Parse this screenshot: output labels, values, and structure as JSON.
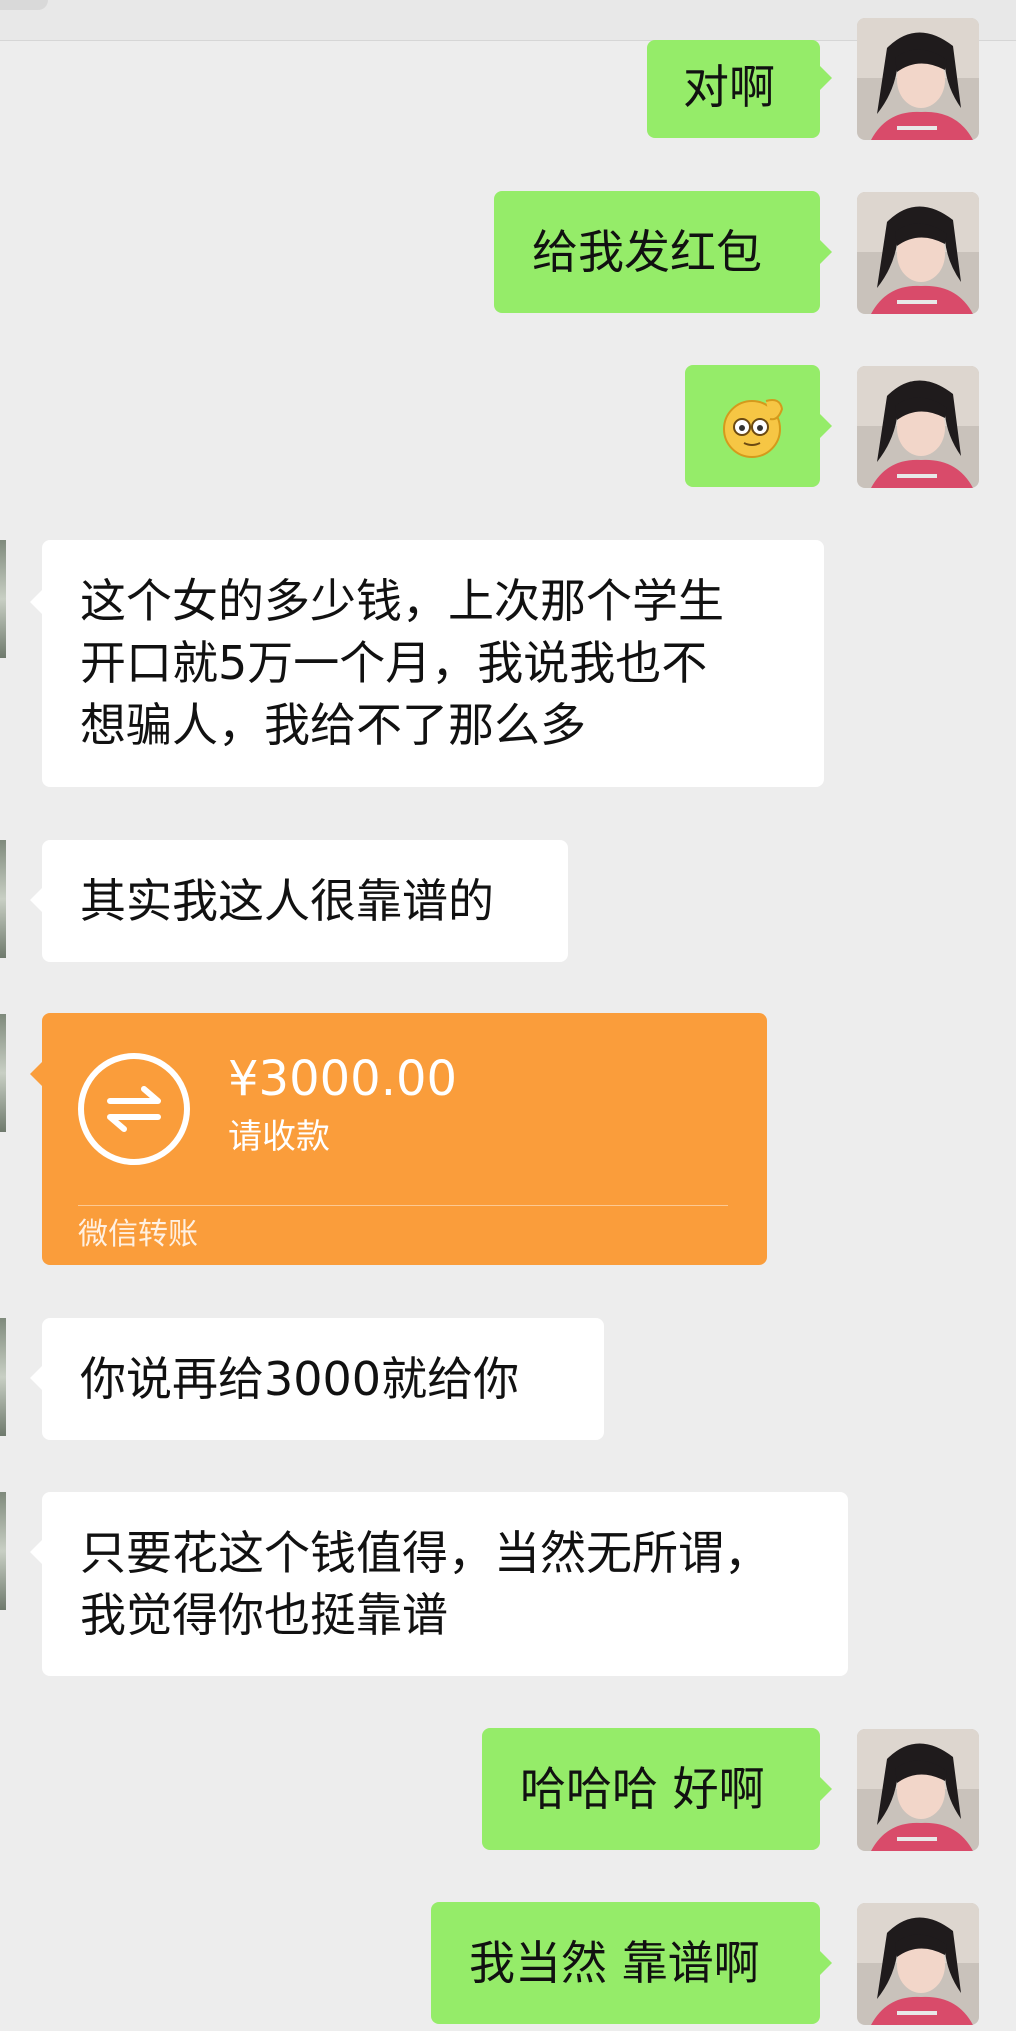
{
  "messages": {
    "m1": {
      "text": "对啊"
    },
    "m2": {
      "text": "给我发红包"
    },
    "m3": {
      "emoji": "salute-face-emoji"
    },
    "m4": {
      "line1": "这个女的多少钱，上次那个学生",
      "line2": "开口就5万一个月，我说我也不",
      "line3": "想骗人，我给不了那么多"
    },
    "m5": {
      "text": "其实我这人很靠谱的"
    },
    "m6": {
      "amount": "¥3000.00",
      "status": "请收款",
      "label": "微信转账"
    },
    "m7": {
      "text": "你说再给3000就给你"
    },
    "m8": {
      "line1": "只要花这个钱值得，当然无所谓，",
      "line2": "我觉得你也挺靠谱"
    },
    "m9": {
      "text": "哈哈哈 好啊"
    },
    "m10": {
      "text": "我当然 靠谱啊"
    }
  },
  "colors": {
    "background": "#ededed",
    "outgoing_bubble": "#95ec69",
    "incoming_bubble": "#ffffff",
    "transfer_card": "#fa9d3b"
  }
}
